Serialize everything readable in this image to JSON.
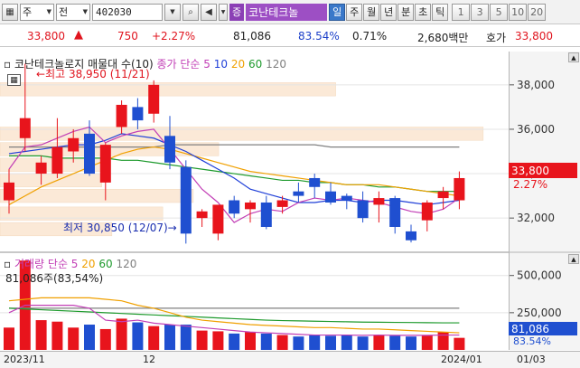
{
  "toolbar": {
    "market_label": "주",
    "type_label": "전",
    "code": "402030",
    "badge": "증",
    "stock_name": "코난테크놀",
    "periods": [
      "일",
      "주",
      "월",
      "년",
      "분",
      "초",
      "틱"
    ],
    "active_period": "일",
    "numbers": [
      "1",
      "3",
      "5",
      "10",
      "20"
    ]
  },
  "quote": {
    "price": "33,800",
    "change": "750",
    "change_pct": "+2.27%",
    "volume": "81,086",
    "volume_ratio": "83.54%",
    "turnover": "0.71%",
    "amount": "2,680백만",
    "ask_label": "호가",
    "ask_price": "33,800"
  },
  "price_chart": {
    "legend_title": "코난테크놀로지 매물대 수(10)",
    "ma_label": "종가 단순 5",
    "ma_periods": [
      "10",
      "20",
      "60",
      "120"
    ],
    "high_label": "최고 38,950 (11/21)",
    "low_label": "최저 30,850 (12/07)",
    "y_ticks": [
      "38,000",
      "36,000",
      "34,000",
      "32,000"
    ],
    "last_price": "33,800",
    "last_pct": "2.27%"
  },
  "volume_chart": {
    "legend_title": "거래량 단순 5",
    "ma_periods": [
      "20",
      "60",
      "120"
    ],
    "current_label": "81,086주(83,54%)",
    "y_ticks": [
      "500,000",
      "250,000"
    ],
    "last_volume": "81,086",
    "last_pct": "83.54%"
  },
  "xaxis": {
    "labels": [
      "2023/11",
      "12",
      "2024/01",
      "01/03"
    ]
  },
  "colors": {
    "up": "#e8141c",
    "down": "#1f4fd0",
    "ma5": "#c23fb6",
    "ma10": "#1f3fd8",
    "ma20": "#f0a000",
    "ma60": "#1e9a2d",
    "ma120": "#808080"
  },
  "chart_data": {
    "type": "candlestick",
    "y_range": [
      30500,
      39500
    ],
    "candles": [
      {
        "o": 32800,
        "h": 34200,
        "l": 32200,
        "c": 33600
      },
      {
        "o": 35600,
        "h": 38950,
        "l": 35000,
        "c": 36500
      },
      {
        "o": 34000,
        "h": 34800,
        "l": 33500,
        "c": 34500
      },
      {
        "o": 34000,
        "h": 36500,
        "l": 33800,
        "c": 35200
      },
      {
        "o": 35000,
        "h": 36000,
        "l": 34500,
        "c": 35600
      },
      {
        "o": 35800,
        "h": 36400,
        "l": 33900,
        "c": 34000
      },
      {
        "o": 33600,
        "h": 35400,
        "l": 32800,
        "c": 35300
      },
      {
        "o": 36100,
        "h": 37300,
        "l": 35800,
        "c": 37100
      },
      {
        "o": 37000,
        "h": 37400,
        "l": 36000,
        "c": 36400
      },
      {
        "o": 36700,
        "h": 38200,
        "l": 36300,
        "c": 38000
      },
      {
        "o": 35700,
        "h": 36600,
        "l": 34200,
        "c": 34500
      },
      {
        "o": 34300,
        "h": 34600,
        "l": 30850,
        "c": 31300
      },
      {
        "o": 32000,
        "h": 32400,
        "l": 31600,
        "c": 32300
      },
      {
        "o": 31300,
        "h": 32200,
        "l": 31000,
        "c": 32600
      },
      {
        "o": 32800,
        "h": 33000,
        "l": 32000,
        "c": 32200
      },
      {
        "o": 32400,
        "h": 32800,
        "l": 31800,
        "c": 32700
      },
      {
        "o": 32700,
        "h": 33000,
        "l": 31500,
        "c": 31600
      },
      {
        "o": 32500,
        "h": 33000,
        "l": 32200,
        "c": 32800
      },
      {
        "o": 33200,
        "h": 33600,
        "l": 32700,
        "c": 33000
      },
      {
        "o": 33800,
        "h": 34000,
        "l": 32900,
        "c": 33400
      },
      {
        "o": 33200,
        "h": 33600,
        "l": 32600,
        "c": 32700
      },
      {
        "o": 33000,
        "h": 33100,
        "l": 32400,
        "c": 32800
      },
      {
        "o": 32800,
        "h": 33200,
        "l": 31800,
        "c": 32000
      },
      {
        "o": 32600,
        "h": 33200,
        "l": 31800,
        "c": 32900
      },
      {
        "o": 32900,
        "h": 33000,
        "l": 31300,
        "c": 31600
      },
      {
        "o": 31400,
        "h": 31700,
        "l": 30900,
        "c": 31000
      },
      {
        "o": 31900,
        "h": 32800,
        "l": 31400,
        "c": 32700
      },
      {
        "o": 32900,
        "h": 33400,
        "l": 32400,
        "c": 33200
      },
      {
        "o": 32800,
        "h": 34100,
        "l": 32400,
        "c": 33800
      }
    ],
    "ma5": [
      34200,
      35200,
      35300,
      35600,
      35900,
      36100,
      35400,
      35700,
      35900,
      36000,
      35100,
      34200,
      33300,
      32700,
      31800,
      32200,
      32400,
      32300,
      32700,
      32900,
      32800,
      32900,
      32800,
      32700,
      32500,
      32300,
      32200,
      32400,
      32900
    ],
    "ma10": [
      34900,
      35000,
      35100,
      35200,
      35300,
      35300,
      35500,
      35800,
      35700,
      35600,
      35300,
      35000,
      34600,
      34200,
      33800,
      33300,
      33100,
      32900,
      32700,
      32700,
      32800,
      32800,
      32700,
      32800,
      32800,
      32700,
      32600,
      32700,
      32800
    ],
    "ma20": [
      32600,
      33000,
      33400,
      33700,
      34000,
      34300,
      34600,
      34900,
      35100,
      35200,
      35100,
      34900,
      34700,
      34500,
      34300,
      34100,
      34000,
      33900,
      33800,
      33700,
      33600,
      33500,
      33500,
      33500,
      33400,
      33300,
      33200,
      33100,
      33000
    ],
    "ma60": [
      34800,
      34800,
      34800,
      34700,
      34700,
      34700,
      34700,
      34600,
      34600,
      34500,
      34400,
      34300,
      34200,
      34100,
      34000,
      33900,
      33800,
      33700,
      33700,
      33600,
      33600,
      33500,
      33500,
      33400,
      33400,
      33300,
      33200,
      33200,
      33200
    ],
    "ma120": [
      35200,
      35200,
      35200,
      35200,
      35200,
      35200,
      35200,
      35200,
      35200,
      35200,
      35300,
      35300,
      35300,
      35300,
      35300,
      35300,
      35300,
      35300,
      35300,
      35300,
      35200,
      35200,
      35200,
      35200,
      35200,
      35200,
      35200,
      35200,
      35200
    ],
    "volume_range": [
      0,
      650000
    ],
    "volumes": [
      150000,
      600000,
      200000,
      190000,
      150000,
      170000,
      140000,
      210000,
      185000,
      160000,
      170000,
      170000,
      130000,
      125000,
      110000,
      120000,
      110000,
      100000,
      90000,
      100000,
      95000,
      100000,
      90000,
      100000,
      95000,
      90000,
      100000,
      120000,
      81086
    ],
    "vol_ma5": [
      250000,
      300000,
      300000,
      300000,
      300000,
      280000,
      200000,
      190000,
      200000,
      180000,
      170000,
      160000,
      150000,
      140000,
      130000,
      120000,
      115000,
      110000,
      105000,
      100000,
      100000,
      100000,
      98000,
      100000,
      98000,
      98000,
      98000,
      100000,
      100000
    ],
    "vol_ma20": [
      330000,
      340000,
      350000,
      350000,
      350000,
      350000,
      340000,
      330000,
      300000,
      280000,
      250000,
      220000,
      200000,
      190000,
      180000,
      170000,
      165000,
      160000,
      155000,
      150000,
      150000,
      145000,
      140000,
      140000,
      135000,
      130000,
      125000,
      120000,
      115000
    ],
    "vol_ma60": [
      280000,
      275000,
      270000,
      265000,
      260000,
      255000,
      250000,
      245000,
      240000,
      235000,
      230000,
      225000,
      220000,
      215000,
      210000,
      205000,
      200000,
      197000,
      195000,
      193000,
      191000,
      189000,
      187000,
      186000,
      185000,
      184000,
      183000,
      182000,
      182000
    ],
    "vol_ma120": [
      280000,
      280000,
      280000,
      280000,
      280000,
      280000,
      280000,
      280000,
      280000,
      280000,
      280000,
      280000,
      280000,
      280000,
      280000,
      280000,
      280000,
      280000,
      280000,
      280000,
      280000,
      280000,
      280000,
      280000,
      280000,
      280000,
      280000,
      280000,
      280000
    ],
    "volume_profile": [
      {
        "from": 37500,
        "to": 38100,
        "width": 0.66
      },
      {
        "from": 35500,
        "to": 36100,
        "width": 0.95
      },
      {
        "from": 34800,
        "to": 35400,
        "width": 0.43
      },
      {
        "from": 34100,
        "to": 34700,
        "width": 0.2
      },
      {
        "from": 33400,
        "to": 34000,
        "width": 0.2
      },
      {
        "from": 32700,
        "to": 33300,
        "width": 0.38
      },
      {
        "from": 31900,
        "to": 32500,
        "width": 0.32
      },
      {
        "from": 31200,
        "to": 31800,
        "width": 0.22
      }
    ]
  }
}
